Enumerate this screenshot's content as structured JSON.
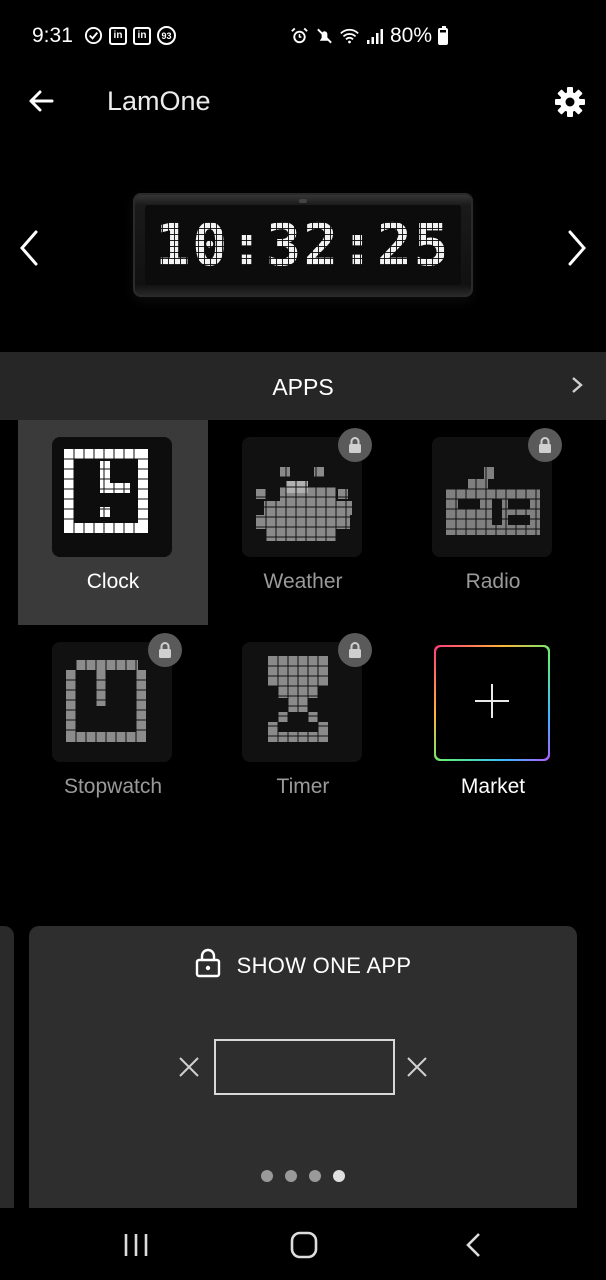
{
  "status_bar": {
    "time": "9:31",
    "badge_number": "93",
    "linkedin_label": "in",
    "battery": "80%"
  },
  "header": {
    "title": "LamOne"
  },
  "device_preview": {
    "display_time": "10:32:25"
  },
  "apps_section": {
    "title": "APPS",
    "apps": [
      {
        "label": "Clock",
        "locked": false,
        "selected": true
      },
      {
        "label": "Weather",
        "locked": true,
        "selected": false
      },
      {
        "label": "Radio",
        "locked": true,
        "selected": false
      },
      {
        "label": "Stopwatch",
        "locked": true,
        "selected": false
      },
      {
        "label": "Timer",
        "locked": true,
        "selected": false
      },
      {
        "label": "Market",
        "locked": false,
        "selected": false
      }
    ]
  },
  "show_one_app": {
    "title": "SHOW ONE APP",
    "page_count": 4,
    "active_page": 4
  },
  "colors": {
    "background": "#000000",
    "apps_bar": "#262626",
    "selected_tile": "#3a3a3a",
    "card": "#2e2e2e",
    "dim_label": "#9a9a9a"
  }
}
